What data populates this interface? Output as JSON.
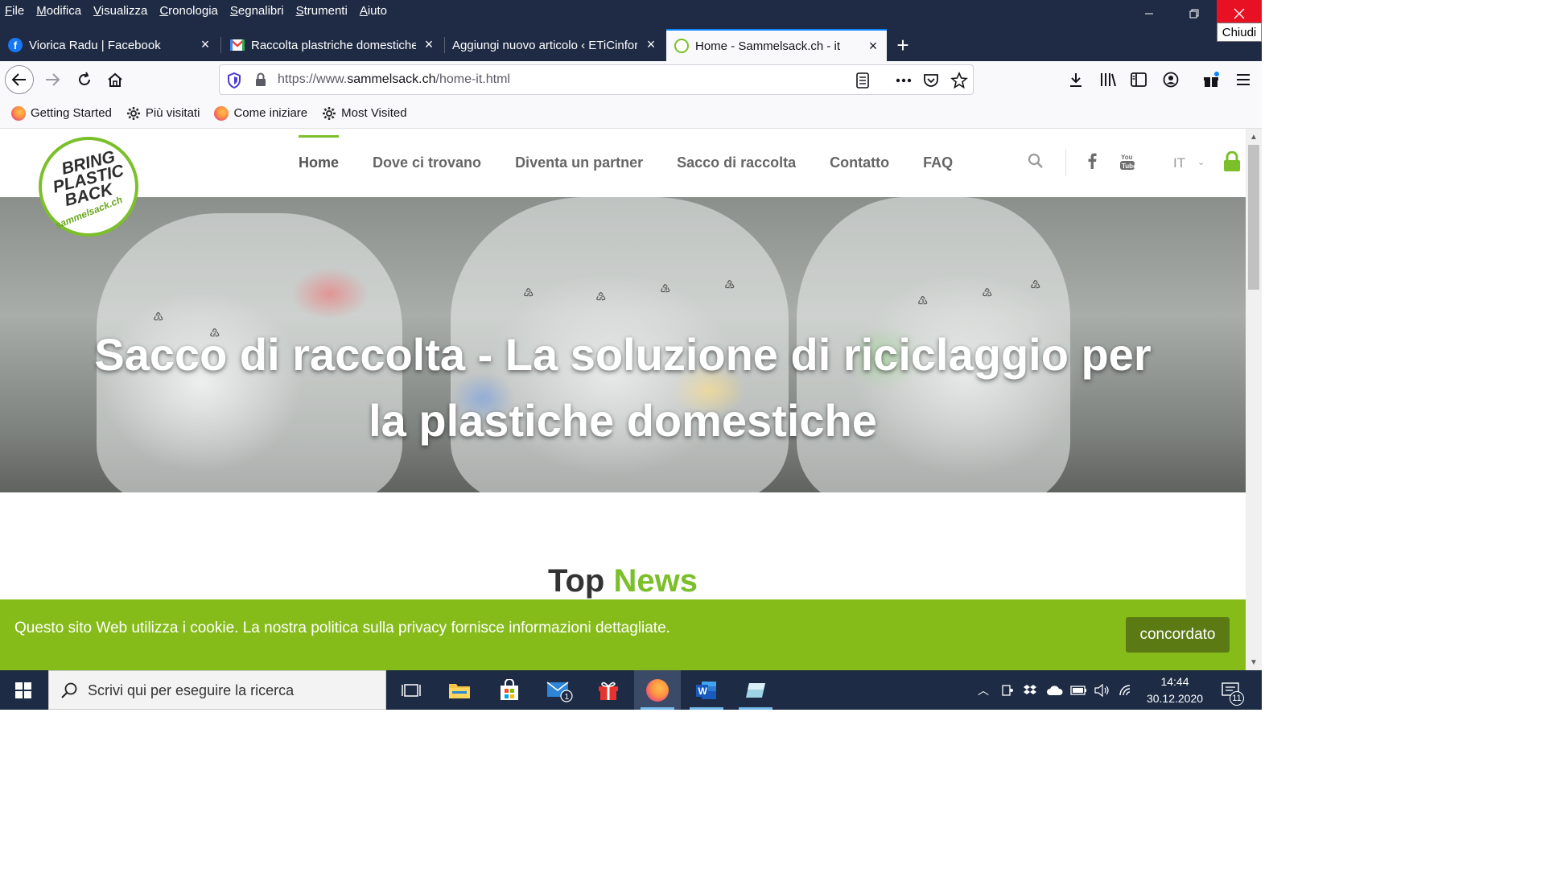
{
  "window": {
    "menu": [
      "File",
      "Modifica",
      "Visualizza",
      "Cronologia",
      "Segnalibri",
      "Strumenti",
      "Aiuto"
    ],
    "close_tooltip": "Chiudi"
  },
  "tabs": [
    {
      "label": "Viorica Radu | Facebook",
      "favicon": "facebook-icon"
    },
    {
      "label": "Raccolta plastriche domestiche",
      "favicon": "gmail-icon"
    },
    {
      "label": "Aggiungi nuovo articolo ‹ ETiCinform",
      "favicon": "none"
    },
    {
      "label": "Home - Sammelsack.ch - it",
      "favicon": "sammelsack-icon",
      "active": true
    }
  ],
  "urlbar": {
    "prefix": "https://www.",
    "domain": "sammelsack.ch",
    "path": "/home-it.html"
  },
  "bookmarks": [
    {
      "label": "Getting Started",
      "icon": "firefox-icon"
    },
    {
      "label": "Più visitati",
      "icon": "gear-icon"
    },
    {
      "label": "Come iniziare",
      "icon": "firefox-icon"
    },
    {
      "label": "Most Visited",
      "icon": "gear-icon"
    }
  ],
  "site": {
    "logo": {
      "line1": "BRING",
      "line2": "PLASTIC",
      "line3": "BACK",
      "sub": "sammelsack.ch"
    },
    "nav": [
      "Home",
      "Dove ci trovano",
      "Diventa un partner",
      "Sacco di raccolta",
      "Contatto",
      "FAQ"
    ],
    "lang": "IT",
    "hero_title_line1": "Sacco di raccolta - La soluzione di riciclaggio per",
    "hero_title_line2": "la plastiche domestiche",
    "topnews_a": "Top",
    "topnews_b": "News",
    "cookie_text": "Questo sito Web utilizza i cookie. La nostra politica sulla privacy fornisce informazioni dettagliate.",
    "cookie_button": "concordato"
  },
  "taskbar": {
    "search_placeholder": "Scrivi qui per eseguire la ricerca",
    "time": "14:44",
    "date": "30.12.2020",
    "mail_badge": "1",
    "notifications": "11"
  },
  "colors": {
    "brand_green": "#7bbf2a",
    "cookie_green": "#86bc1a",
    "browser_dark": "#1f2a44"
  }
}
